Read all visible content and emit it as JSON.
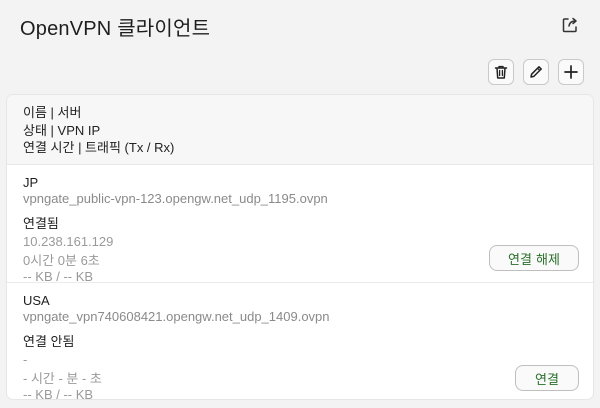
{
  "header": {
    "title": "OpenVPN 클라이언트",
    "export_icon": "export-icon"
  },
  "toolbar": {
    "delete_icon": "trash-icon",
    "edit_icon": "pencil-icon",
    "add_icon": "plus-icon"
  },
  "columns": {
    "line1": "이름 | 서버",
    "line2": "상태 | VPN IP",
    "line3": "연결 시간 | 트래픽 (Tx / Rx)"
  },
  "connections": [
    {
      "name": "JP",
      "file": "vpngate_public-vpn-123.opengw.net_udp_1195.ovpn",
      "status": "연결됨",
      "vpn_ip": "10.238.161.129",
      "duration": "0시간 0분 6초",
      "traffic": "-- KB / -- KB",
      "action_label": "연결 해제"
    },
    {
      "name": "USA",
      "file": "vpngate_vpn740608421.opengw.net_udp_1409.ovpn",
      "status": "연결 안됨",
      "vpn_ip": "-",
      "duration": "- 시간 - 분 - 초",
      "traffic": "-- KB / -- KB",
      "action_label": "연결"
    }
  ],
  "colors": {
    "action_text": "#2a6f2a",
    "secondary_text": "#8a8a8a"
  }
}
